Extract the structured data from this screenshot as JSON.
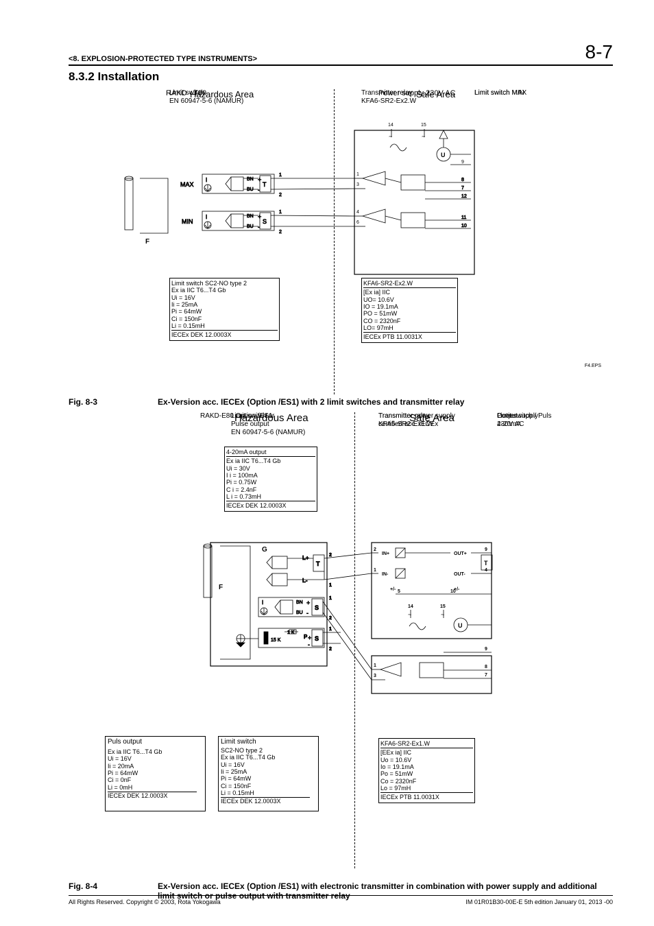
{
  "header": {
    "title": "<8. EXPLOSION-PROTECTED TYPE INSTRUMENTS>",
    "page": "8-7"
  },
  "section": "8.3.2  Installation",
  "fig1": {
    "hazArea": "Hazardous Area",
    "safeArea": "Safe Area",
    "ps": "Power supply 230V AC",
    "rakd": "RAKD - T80",
    "max": "MAX",
    "min": "MIN",
    "F": "F",
    "T": "T",
    "S": "S",
    "I": "I",
    "BN": "BN",
    "BU": "BU",
    "lsmax": "Limit switch MAX",
    "lsmin": "Limit switch MIN",
    "lsTitle": "Limit switch",
    "lsNorm": "EN 60947-5-6 (NAMUR)",
    "txTitle": "Transmitter relay",
    "txModel": "KFA6-SR2-Ex2.W",
    "pin1": "1",
    "pin2": "2",
    "pin3": "3",
    "pin4": "4",
    "pin6": "6",
    "pin7": "7",
    "pin8": "8",
    "pin9": "9",
    "pin10": "10",
    "pin11": "11",
    "pin12": "12",
    "pin14": "14",
    "pin15": "15",
    "tilde": "~",
    "U": "U",
    "specLeft": {
      "l1": "Limit switch SC2-NO type 2",
      "l2": "Ex  ia IIC T6...T4 Gb",
      "l3": "Ui  = 16V",
      "l4": "Ii   = 25mA",
      "l5": "Pi   = 64mW",
      "l6": "Ci   = 150nF",
      "l7": "Li  = 0.15mH",
      "l8": "IECEx DEK 12.0003X"
    },
    "specRight": {
      "l1": "KFA6-SR2-Ex2.W",
      "l2": "[Ex ia] IIC",
      "l3": "UO= 10.6V",
      "l4": "IO = 19.1mA",
      "l5": "PO = 51mW",
      "l6": "CO = 2320nF",
      "l7": "LO= 97mH",
      "l8": "IECEx PTB 11.0031X"
    },
    "eps": "F4.EPS"
  },
  "cap1": {
    "n": "Fig. 8-3",
    "t": "Ex-Version acc. IECEx (Option /ES1) with 2 limit switches and transmitter relay"
  },
  "fig2": {
    "hazArea": "Hazardous Area",
    "safeArea": "Safe Area",
    "rakd": "RAKD-E80 Option /ES1",
    "F": "F",
    "G": "G",
    "T": "T",
    "S": "S",
    "I": "I",
    "BN": "BN",
    "BU": "BU",
    "Lplus": "L+",
    "Lminus": "L-",
    "P": "P",
    "lsTitle": "Limit switch or",
    "lsTitle2": "Pulse output",
    "lsNorm": "EN 60947-5-6 (NAMUR)",
    "txpsTitle": "Transmitter power supply",
    "txpsCert": "certified acc. IECEx",
    "out": "Output",
    "out2": "4-20mA",
    "ps": "Power supply",
    "ps2": "230V AC",
    "lsPuls": "Limit switch / Puls",
    "txTitle": "Transmitter relay",
    "txModel": "KFA6-SR2-Ex1.W",
    "in+": "IN+",
    "in-": "IN-",
    "out+": "OUT+",
    "out-": "OUT-",
    "plusm": "+/-",
    "pin1": "1",
    "pin2": "2",
    "pin3": "3",
    "pin4": "4",
    "pin5": "5",
    "pin7": "7",
    "pin8": "8",
    "pin9": "9",
    "pin10": "10",
    "pin14": "14",
    "pin15": "15",
    "tilde": "~",
    "U": "U",
    "oneK": "1 K",
    "fifteenK": "15 K",
    "specTop": {
      "l1": "4-20mA output",
      "l2": "Ex  ia IIC T6...T4 Gb",
      "l3": "Ui  = 30V",
      "l4": "I i   = 100mA",
      "l5": "Pi  = 0.75W",
      "l6": "C i = 2.4nF",
      "l7": "L i = 0.73mH",
      "l8": "IECEx DEK 12.0003X"
    },
    "specPuls": {
      "t": "Puls output",
      "l2": "Ex  ia IIC T6...T4 Gb",
      "l3": "Ui  = 16V",
      "l4": "Ii   = 20mA",
      "l5": "Pi   = 64mW",
      "l6": "Ci   = 0nF",
      "l7": "Li  = 0mH",
      "l8": "IECEx DEK 12.0003X"
    },
    "specLS": {
      "t": "Limit switch",
      "l1": "SC2-NO type 2",
      "l2": "Ex  ia IIC T6...T4 Gb",
      "l3": "Ui  = 16V",
      "l4": "Ii   = 25mA",
      "l5": "Pi   = 64mW",
      "l6": "Ci   = 150nF",
      "l7": "Li  = 0.15mH",
      "l8": "IECEx DEK 12.0003X"
    },
    "specRight": {
      "l1": "KFA6-SR2-Ex1.W",
      "l2": "[EEx  ia]  IIC",
      "l3": "Uo  = 10.6V",
      "l4": "Io   = 19.1mA",
      "l5": "Po   = 51mW",
      "l6": "Co   = 2320nF",
      "l7": "Lo   = 97mH",
      "l8": "IECEx PTB 11.0031X"
    }
  },
  "cap2": {
    "n": "Fig. 8-4",
    "t": "Ex-Version acc. IECEx (Option /ES1) with electronic transmitter in combination with power supply and additional limit switch or pulse output with transmitter relay"
  },
  "footer": {
    "l": "All Rights Reserved. Copyright © 2003, Rota Yokogawa",
    "r": "IM 01R01B30-00E-E    5th edition January 01, 2013 -00"
  }
}
